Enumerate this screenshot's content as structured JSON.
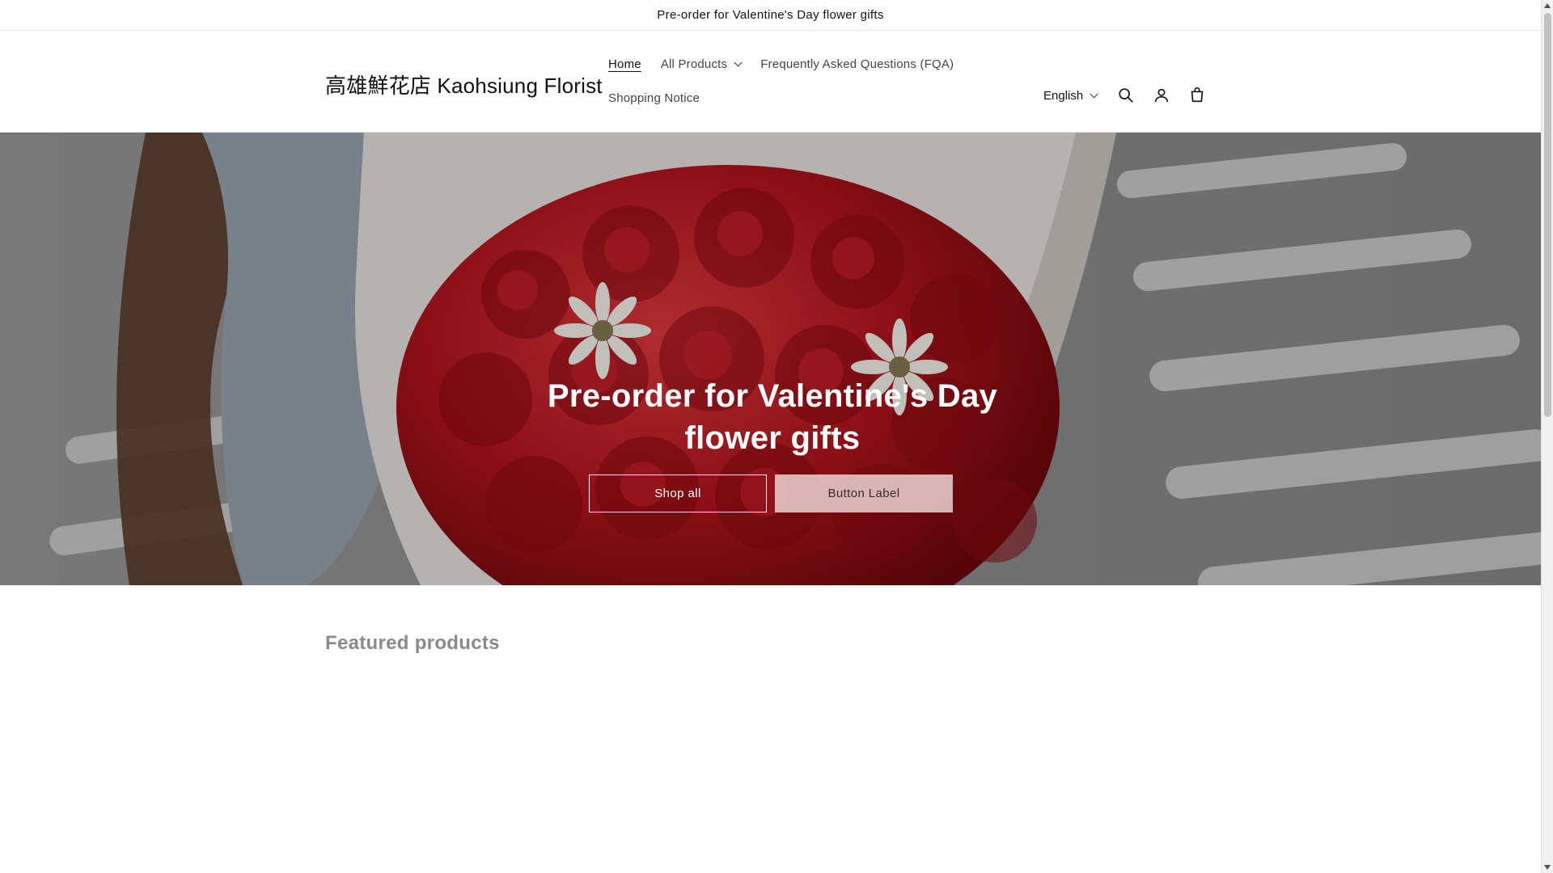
{
  "announcement": {
    "text": "Pre-order for Valentine's Day flower gifts"
  },
  "header": {
    "logo": "高雄鮮花店 Kaohsiung Florist",
    "nav": [
      {
        "label": "Home",
        "active": true
      },
      {
        "label": "All Products",
        "dropdown": true
      },
      {
        "label": "Frequently Asked Questions (FQA)"
      },
      {
        "label": "Shopping Notice"
      }
    ],
    "language": "English",
    "icons": [
      "search-icon",
      "account-icon",
      "cart-icon"
    ]
  },
  "hero": {
    "title": "Pre-order for Valentine's Day flower gifts",
    "buttons": {
      "primary": "Shop all",
      "secondary": "Button Label"
    }
  },
  "featured": {
    "title": "Featured products"
  },
  "colors": {
    "text": "#121212",
    "muted": "#8a8a8a",
    "rose": "#b3141c",
    "border": "#e6e6e6"
  }
}
